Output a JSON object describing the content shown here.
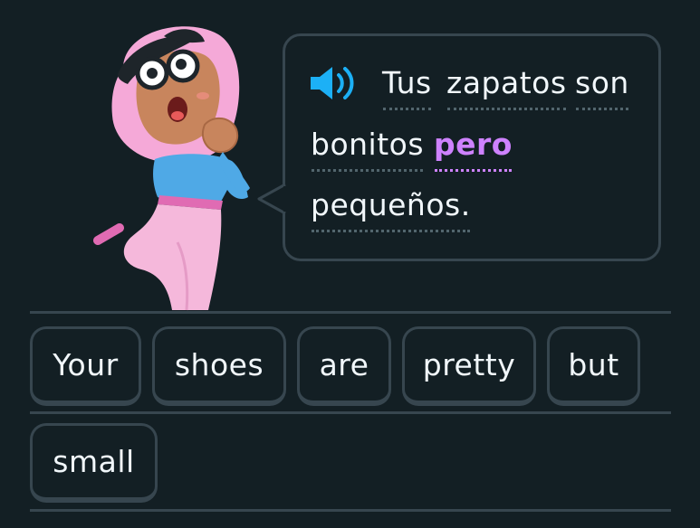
{
  "prompt": {
    "sentence": [
      "Tus",
      "zapatos",
      "son",
      "bonitos",
      "pero",
      "pequeños."
    ],
    "highlighted_word": "pero",
    "speaker_icon": "speaker-icon"
  },
  "answer_tiles": [
    "Your",
    "shoes",
    "are",
    "pretty",
    "but",
    "small"
  ],
  "colors": {
    "background": "#131f24",
    "border": "#37464f",
    "text": "#f1f7fb",
    "highlight": "#ce82ff",
    "speaker": "#1cb0f6"
  }
}
